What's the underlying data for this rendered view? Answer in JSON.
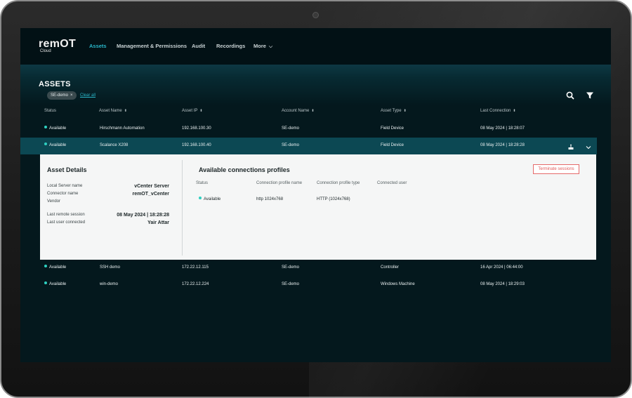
{
  "app": {
    "logo": "remOT",
    "logo_sub": "Cloud"
  },
  "nav": {
    "items": [
      {
        "label": "Assets",
        "active": true
      },
      {
        "label": "Management & Permissions",
        "active": false
      },
      {
        "label": "Audit",
        "active": false
      },
      {
        "label": "Recordings",
        "active": false
      },
      {
        "label": "More",
        "active": false
      }
    ]
  },
  "page": {
    "title": "ASSETS"
  },
  "filters": {
    "chip": "SE-demo",
    "chip_remove": "×",
    "clear_all": "Clear all"
  },
  "table": {
    "columns": [
      "Status",
      "Asset Name",
      "Asset IP",
      "Account Name",
      "Asset Type",
      "Last Connection"
    ],
    "rows": [
      {
        "status": "Available",
        "name": "Hirschmann Automation",
        "ip": "192.168.100.30",
        "account": "SE-demo",
        "type": "Field Device",
        "last": "08 May 2024 | 18:28:07"
      },
      {
        "status": "Available",
        "name": "Scalance X208",
        "ip": "192.168.100.40",
        "account": "SE-demo",
        "type": "Field Device",
        "last": "08 May 2024 | 18:28:28"
      },
      {
        "status": "Available",
        "name": "SSH demo",
        "ip": "172.22.12.115",
        "account": "SE-demo",
        "type": "Controller",
        "last": "16 Apr 2024 | 06:44:00"
      },
      {
        "status": "Available",
        "name": "win-demo",
        "ip": "172.22.12.224",
        "account": "SE-demo",
        "type": "Windows Machine",
        "last": "08 May 2024 | 18:29:03"
      }
    ]
  },
  "details": {
    "title": "Asset Details",
    "fields": [
      {
        "label": "Local Server name",
        "value": "vCenter Server"
      },
      {
        "label": "Connector name",
        "value": "remOT_vCenter"
      },
      {
        "label": "Vendor",
        "value": ""
      },
      {
        "label": "Last remote session",
        "value": "08 May 2024 | 18:28:28"
      },
      {
        "label": "Last user connected",
        "value": "Yair Attar"
      }
    ],
    "profiles_title": "Available connections profiles",
    "terminate_label": "Terminate sessions",
    "profile_columns": [
      "Status",
      "Connection profile name",
      "Connection profile type",
      "Connected user"
    ],
    "profiles": [
      {
        "status": "Available",
        "name": "http 1024x768",
        "type": "HTTP (1024x768)",
        "user": ""
      }
    ]
  },
  "colors": {
    "accent": "#29b6c9",
    "available_dot": "#2ecfc0",
    "selected_row": "#0c4853",
    "terminate": "#e05a5a"
  },
  "icons": [
    "search-icon",
    "filter-icon",
    "connect-icon",
    "chevron-down-icon"
  ]
}
